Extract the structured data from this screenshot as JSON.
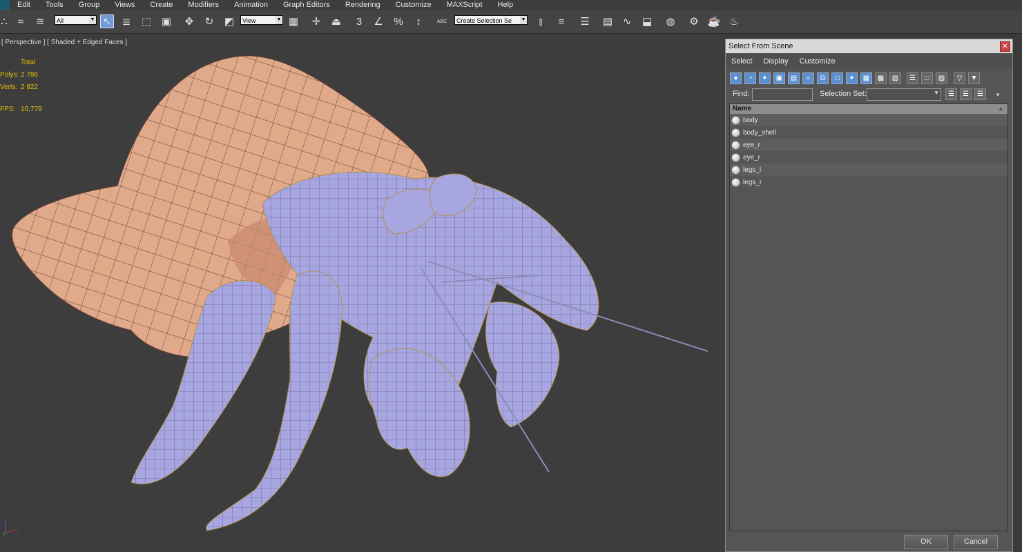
{
  "menu": [
    "Edit",
    "Tools",
    "Group",
    "Views",
    "Create",
    "Modifiers",
    "Animation",
    "Graph Editors",
    "Rendering",
    "Customize",
    "MAXScript",
    "Help"
  ],
  "toolbar": {
    "selection_filter": "All",
    "reference_coord": "View",
    "named_selection_placeholder": "Create Selection Se",
    "snap_3_label": "3",
    "percent_snap_label": "%",
    "abc_label": "ABC"
  },
  "viewport": {
    "label": "[ Perspective ] [ Shaded + Edged Faces ]",
    "stats": {
      "header": "Total",
      "polys_label": "Polys:",
      "polys_value": "2 786",
      "verts_label": "Verts:",
      "verts_value": "2 822",
      "fps_label": "FPS:",
      "fps_value": "10,779"
    }
  },
  "dialog": {
    "title": "Select From Scene",
    "menu": [
      "Select",
      "Display",
      "Customize"
    ],
    "find_label": "Find:",
    "selection_set_label": "Selection Set:",
    "column_header": "Name",
    "objects": [
      "body",
      "body_shell",
      "eye_r",
      "eye_r",
      "legs_l",
      "legs_r"
    ],
    "ok_label": "OK",
    "cancel_label": "Cancel"
  },
  "colors": {
    "shell": "#e0a98a",
    "crab": "#a7a6e0",
    "hair": "#b48c28",
    "stats_text": "#e3c000",
    "selection_blue": "#5b8fd2"
  }
}
